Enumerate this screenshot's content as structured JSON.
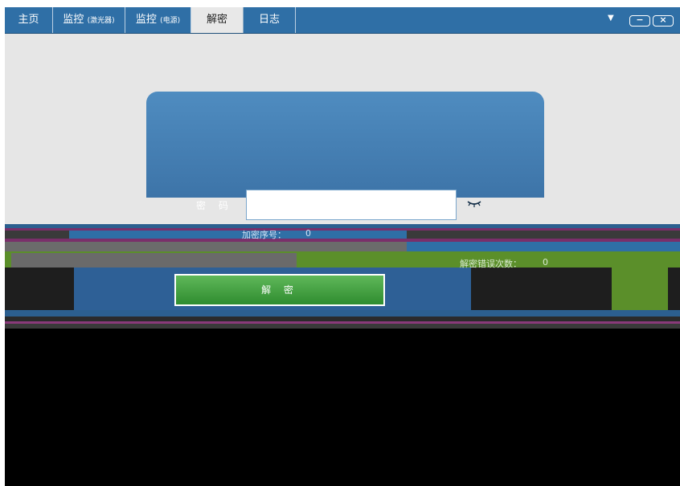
{
  "tabs": [
    {
      "label": "主页",
      "sub": ""
    },
    {
      "label": "监控",
      "sub": "(激光器)"
    },
    {
      "label": "监控",
      "sub": "(电源)"
    },
    {
      "label": "解密",
      "sub": ""
    },
    {
      "label": "日志",
      "sub": ""
    }
  ],
  "window_controls": {
    "dropdown": "▼",
    "minimize": "−",
    "close": "×"
  },
  "form": {
    "password_label": "密 码",
    "password_value": "",
    "eye_icon": "eye-closed-icon"
  },
  "status": {
    "encryption_serial_label": "加密序号：",
    "encryption_serial_value": "0",
    "error_count_label": "解密错误次数：",
    "error_count_value": "0"
  },
  "button": {
    "decrypt_label": "解 密"
  },
  "colors": {
    "topbar": "#2f6fa6",
    "card": "#4a86bb",
    "button": "#3fa03a",
    "content_bg": "#e6e6e6"
  }
}
